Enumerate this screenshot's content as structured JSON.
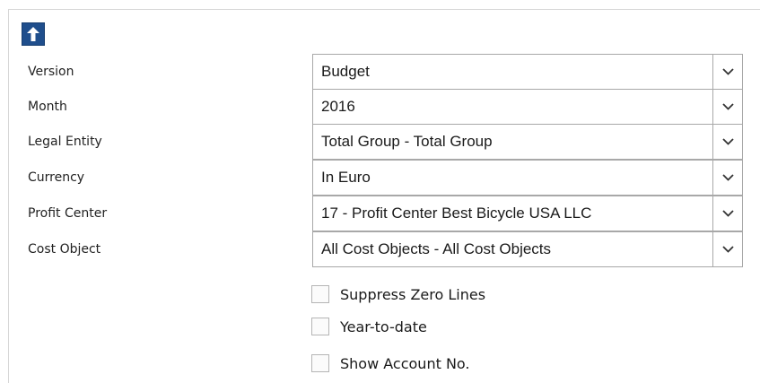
{
  "navigation": {
    "up_icon": "arrow-up-icon"
  },
  "filters": [
    {
      "label": "Version",
      "value": "Budget"
    },
    {
      "label": "Month",
      "value": "2016"
    },
    {
      "label": "Legal Entity",
      "value": "Total Group - Total Group"
    },
    {
      "label": "Currency",
      "value": "In Euro"
    },
    {
      "label": "Profit Center",
      "value": "17 - Profit Center Best Bicycle USA LLC"
    },
    {
      "label": "Cost Object",
      "value": "All Cost Objects - All Cost Objects"
    }
  ],
  "options": [
    {
      "label": "Suppress Zero Lines",
      "checked": false
    },
    {
      "label": "Year-to-date",
      "checked": false
    },
    {
      "label": "Show Account No.",
      "checked": false
    }
  ],
  "colors": {
    "accent": "#1f4e8c",
    "border": "#a8a8a8"
  },
  "dropdown_icon": "chevron-down-icon"
}
